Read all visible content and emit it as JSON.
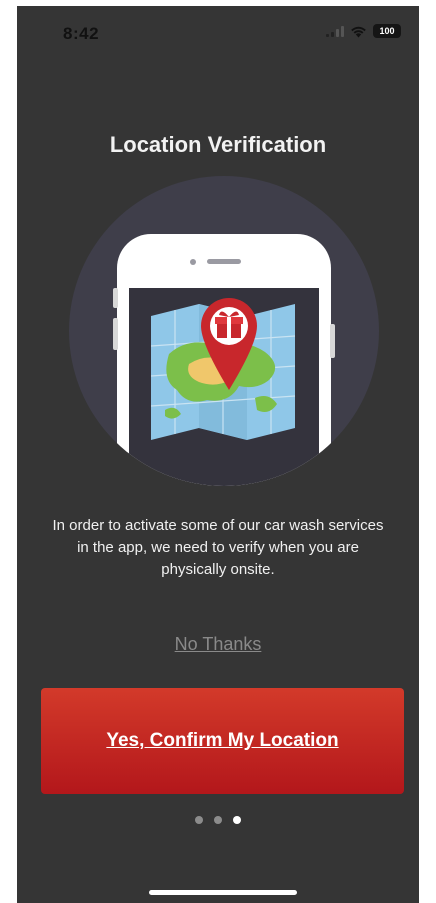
{
  "status_bar": {
    "time": "8:42",
    "battery": "100"
  },
  "screen": {
    "title": "Location Verification",
    "description": "In order to activate some of our car wash services in the app, we need to verify when you are physically onsite.",
    "no_thanks_label": "No Thanks",
    "confirm_label": "Yes, Confirm My Location"
  },
  "pager": {
    "total": 3,
    "active_index": 2
  },
  "colors": {
    "background": "#353535",
    "accent": "#c92a22",
    "map_green": "#7cbf4a",
    "map_water": "#8fc7e8"
  },
  "icons": [
    "cellular-signal-icon",
    "wifi-icon",
    "battery-icon",
    "phone-map-illustration",
    "location-pin-icon",
    "gift-icon"
  ]
}
